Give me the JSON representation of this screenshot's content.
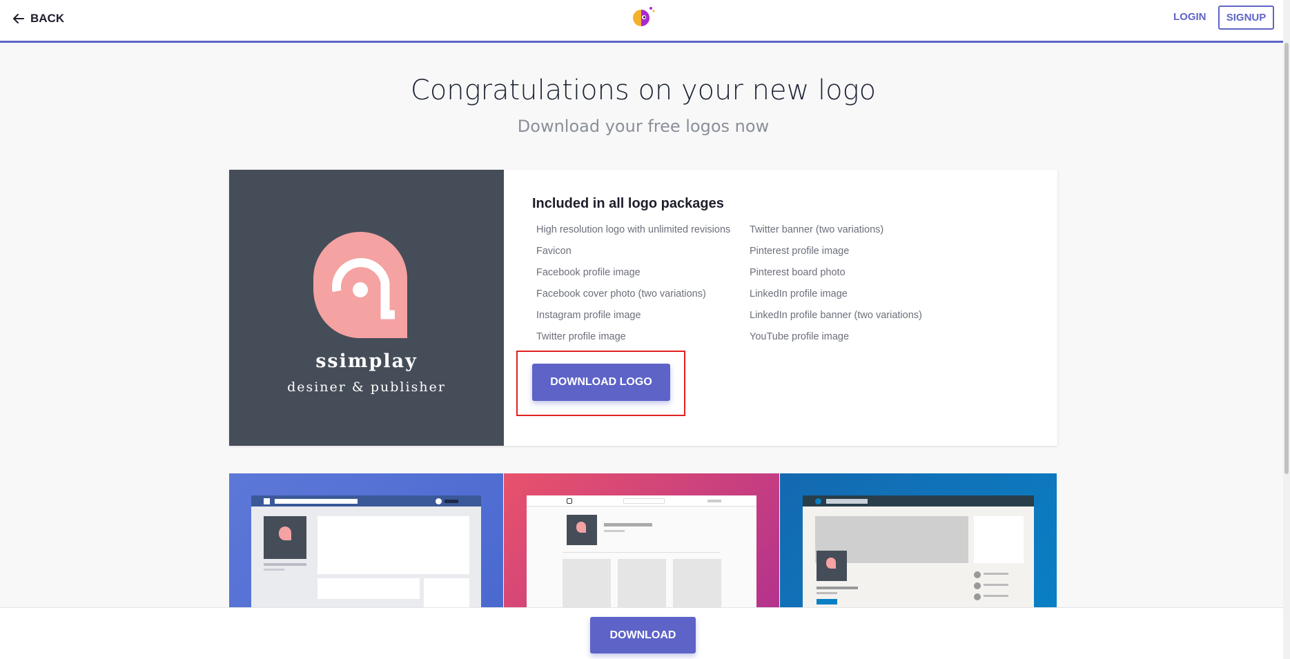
{
  "header": {
    "back_label": "BACK",
    "login_label": "LOGIN",
    "signup_label": "SIGNUP",
    "accent_color": "#5d63c7"
  },
  "main": {
    "title": "Congratulations on your new logo",
    "subtitle": "Download your free logos now"
  },
  "logo_preview": {
    "name": "ssimplay",
    "tagline": "desiner & publisher",
    "background_color": "#454d58",
    "mark_color": "#f4a2a2"
  },
  "package": {
    "heading": "Included in all logo packages",
    "features_col1": [
      "High resolution logo with unlimited revisions",
      "Favicon",
      "Facebook profile image",
      "Facebook cover photo (two variations)",
      "Instagram profile image",
      "Twitter profile image"
    ],
    "features_col2": [
      "Twitter banner (two variations)",
      "Pinterest profile image",
      "Pinterest board photo",
      "LinkedIn profile image",
      "LinkedIn profile banner (two variations)",
      "YouTube profile image"
    ],
    "download_logo_label": "DOWNLOAD LOGO"
  },
  "bottom": {
    "download_label": "DOWNLOAD"
  },
  "mockups": [
    {
      "icon": "facebook-mockup",
      "color": "#5c78d8"
    },
    {
      "icon": "instagram-mockup",
      "color": "#e8526b"
    },
    {
      "icon": "linkedin-mockup",
      "color": "#1469b0"
    }
  ]
}
